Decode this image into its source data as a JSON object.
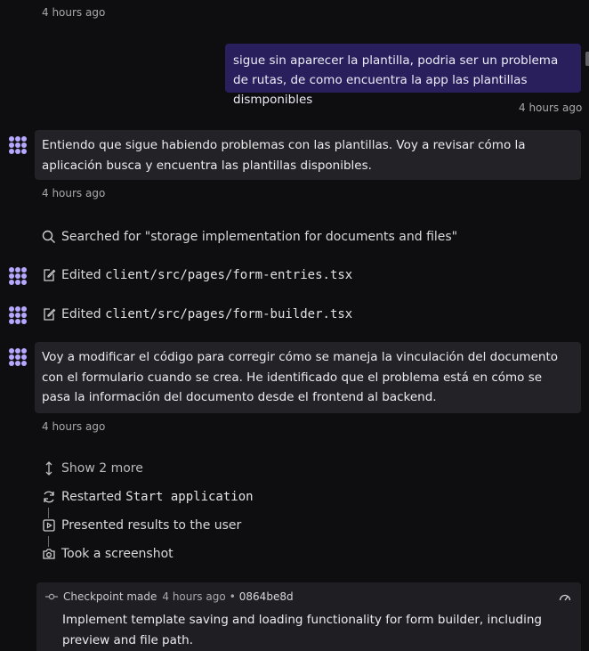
{
  "chat": {
    "top_timestamp": "4 hours ago",
    "user_message": {
      "text": "sigue sin aparecer la plantilla, podria ser un problema de rutas, de como encuentra la app las plantillas dismponibles",
      "timestamp": "4 hours ago"
    },
    "agent_message_1": {
      "text": "Entiendo que sigue habiendo problemas con las plantillas. Voy a revisar cómo la aplicación busca y encuentra las plantillas disponibles.",
      "timestamp": "4 hours ago"
    },
    "search_action": {
      "label": "Searched for \"storage implementation for documents and files\""
    },
    "edit_actions": [
      {
        "label": "Edited",
        "path": "client/src/pages/form-entries.tsx"
      },
      {
        "label": "Edited",
        "path": "client/src/pages/form-builder.tsx"
      }
    ],
    "agent_message_2": {
      "text": "Voy a modificar el código para corregir cómo se maneja la vinculación del documento con el formulario cuando se crea. He identificado que el problema está en cómo se pasa la información del documento desde el frontend al backend.",
      "timestamp": "4 hours ago"
    },
    "show_more": {
      "label": "Show 2 more"
    },
    "timeline": [
      {
        "icon": "restart-icon",
        "label": "Restarted",
        "code": "Start application"
      },
      {
        "icon": "present-icon",
        "label": "Presented results to the user",
        "code": ""
      },
      {
        "icon": "camera-icon",
        "label": "Took a screenshot",
        "code": ""
      }
    ],
    "checkpoint": {
      "label": "Checkpoint made",
      "time": "4 hours ago",
      "separator": "•",
      "commit": "0864be8d",
      "description": "Implement template saving and loading functionality for form builder, including preview and file path."
    }
  },
  "colors": {
    "background": "#0e0e10",
    "user_bubble": "#281f5c",
    "agent_bubble": "#222227",
    "avatar": "#b7a8ff"
  }
}
